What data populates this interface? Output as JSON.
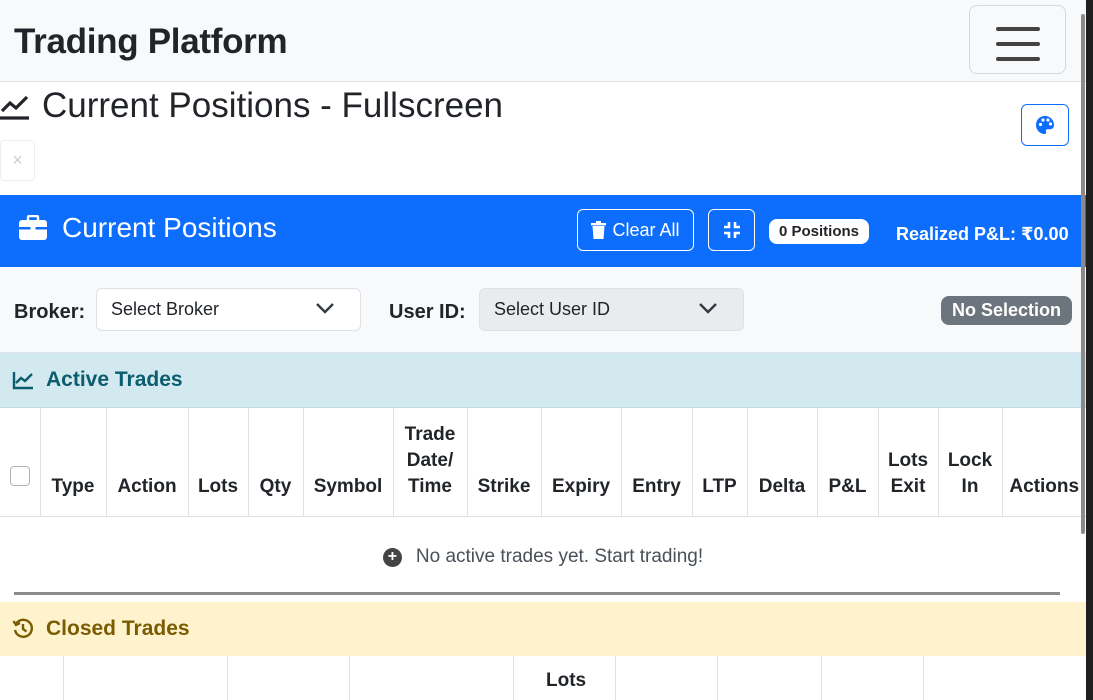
{
  "navbar": {
    "brand": "Trading Platform",
    "menu_icon": "hamburger-icon"
  },
  "page": {
    "title": "Current Positions - Fullscreen",
    "title_icon": "line-chart-icon",
    "theme_icon": "palette-icon",
    "close_label": "×"
  },
  "positions_header": {
    "title": "Current Positions",
    "title_icon": "briefcase-icon",
    "clear_all_label": "Clear All",
    "clear_icon": "trash-icon",
    "collapse_icon": "compress-icon",
    "positions_count": "0 Positions",
    "realized_pnl": "Realized P&L: ₹0.00"
  },
  "filters": {
    "broker_label": "Broker:",
    "broker_placeholder": "Select Broker",
    "user_label": "User ID:",
    "user_placeholder": "Select User ID",
    "selection_badge": "No Selection"
  },
  "active_trades": {
    "title": "Active Trades",
    "columns": [
      "",
      "Type",
      "Action",
      "Lots",
      "Qty",
      "Symbol",
      "Trade\nDate/\nTime",
      "Strike",
      "Expiry",
      "Entry",
      "LTP",
      "Delta",
      "P&L",
      "Lots\nExit",
      "Lock\nIn",
      "Actions"
    ],
    "empty_message": "No active trades yet. Start trading!"
  },
  "closed_trades": {
    "title": "Closed Trades",
    "visible_header": "Lots"
  },
  "colors": {
    "primary": "#0d6efd",
    "info_bg": "#d1e9ef",
    "warning_bg": "#fff3cd",
    "secondary": "#6c757d"
  }
}
